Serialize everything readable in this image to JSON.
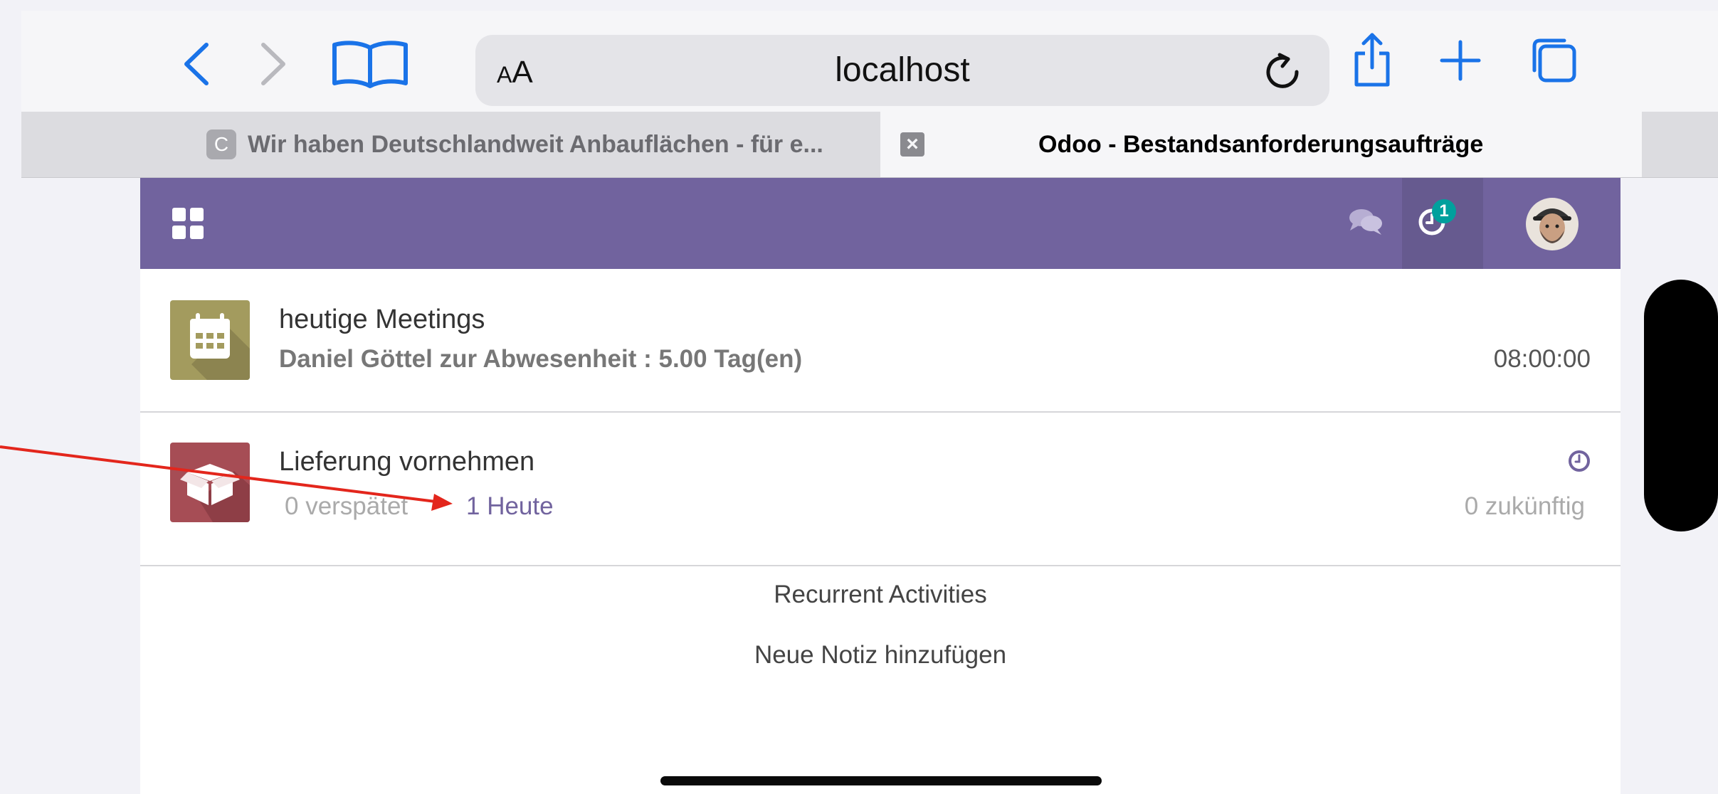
{
  "browser": {
    "url": "localhost",
    "aa_label_small": "A",
    "aa_label_large": "A",
    "tabs": [
      {
        "favicon": "C",
        "title": "Wir haben Deutschlandweit Anbauflächen - für e..."
      },
      {
        "title": "Odoo - Bestandsanforderungsaufträge"
      }
    ]
  },
  "odoo": {
    "navbar": {
      "activity_count": "1"
    },
    "activities": [
      {
        "title": "heutige Meetings",
        "subtitle": "Daniel Göttel zur Abwesenheit : 5.00 Tag(en)",
        "time": "08:00:00",
        "icon": "calendar-icon",
        "icon_color": "#a39b5e"
      },
      {
        "title": "Lieferung vornehmen",
        "late": "0 verspätet",
        "today": "1 Heute",
        "future": "0 zukünftig",
        "icon": "box-icon",
        "icon_color": "#a64d55"
      }
    ],
    "recurrent_label": "Recurrent Activities",
    "new_note_label": "Neue Notiz hinzufügen"
  },
  "colors": {
    "navbar": "#71639e",
    "badge": "#00a09d",
    "annotation_arrow": "#e3261c"
  }
}
